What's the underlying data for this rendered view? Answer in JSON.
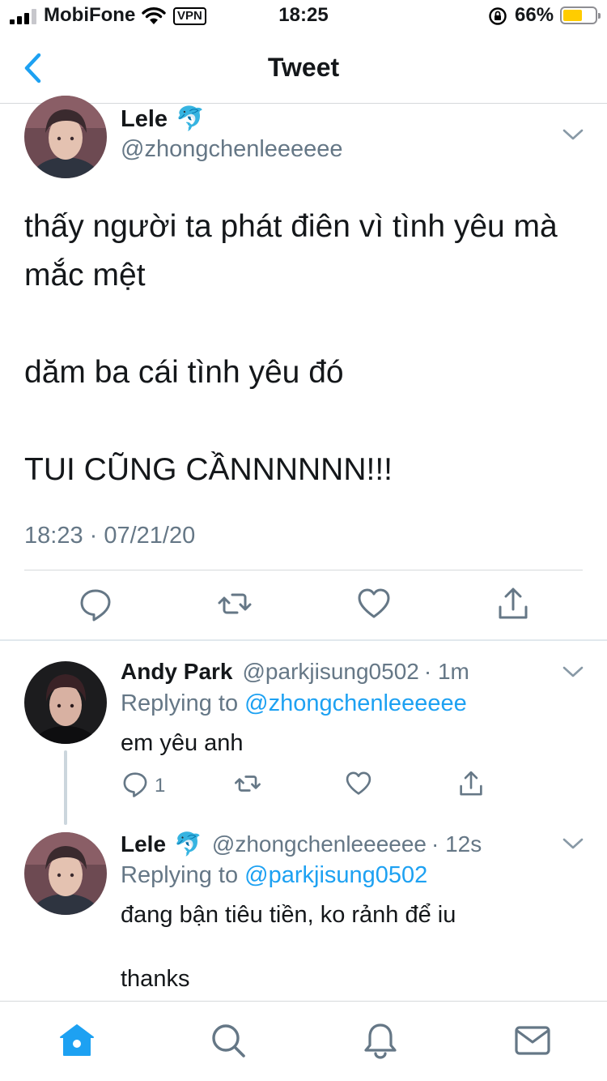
{
  "status_bar": {
    "carrier": "MobiFone",
    "vpn": "VPN",
    "time": "18:25",
    "battery_percent": "66%",
    "signal_bars_active": 3,
    "battery_level": 0.6,
    "colors": {
      "battery": "#ffcc00"
    }
  },
  "nav": {
    "title": "Tweet",
    "back_icon": "chevron-left-icon"
  },
  "tweet": {
    "author_name": "Lele",
    "author_emoji": "🐬",
    "author_handle": "@zhongchenleeeeee",
    "text_lines": [
      "thấy người ta phát điên vì tình yêu mà mắc mệt",
      "dăm ba cái tình yêu đó",
      "TUI CŨNG CẦNNNNNN!!!"
    ],
    "timestamp": "18:23 · 07/21/20",
    "actions": [
      "reply-icon",
      "retweet-icon",
      "like-icon",
      "share-icon"
    ]
  },
  "replies": [
    {
      "author_name": "Andy Park",
      "author_handle": "@parkjisung0502",
      "age": "· 1m",
      "replying_prefix": "Replying to",
      "replying_to": "@zhongchenleeeeee",
      "text": "em yêu anh",
      "reply_count": "1"
    },
    {
      "author_name": "Lele",
      "author_emoji": "🐬",
      "author_handle": "@zhongchenleeeeee",
      "age": "· 12s",
      "replying_prefix": "Replying to",
      "replying_to": "@parkjisung0502",
      "text_line1": "đang bận tiêu tiền, ko rảnh để iu",
      "text_line2": "thanks"
    }
  ],
  "tab_bar": {
    "tabs": [
      "home-icon",
      "search-icon",
      "notifications-icon",
      "messages-icon"
    ],
    "active": "home-icon"
  },
  "colors": {
    "accent": "#1da1f2",
    "text": "#14171a",
    "secondary": "#657786",
    "divider": "#d6d9db"
  }
}
